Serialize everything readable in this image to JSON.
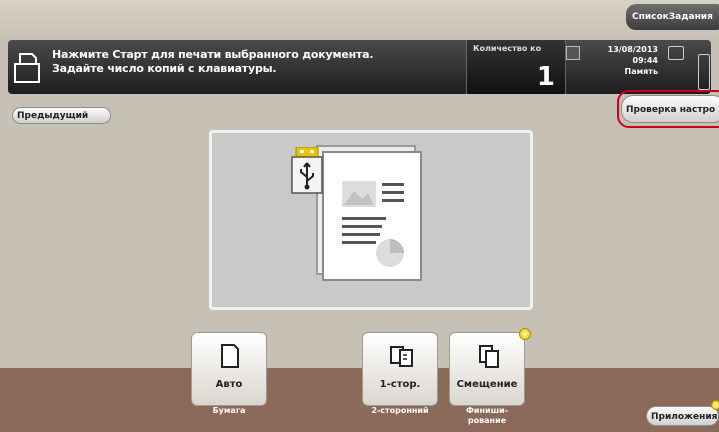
{
  "header": {
    "job_list_label": "СписокЗадания",
    "message_line1": "Нажмите Старт для печати выбранного документа.",
    "message_line2": "Задайте число копий с клавиатуры.",
    "copies_label": "Количество ко",
    "copies_value": "1",
    "date": "13/08/2013",
    "time": "09:44",
    "memory_label": "Память"
  },
  "nav": {
    "previous_label": "Предыдущий",
    "check_settings_label": "Проверка настро"
  },
  "preview": {
    "document_icon": "document-preview-icon",
    "source_icon": "usb-icon"
  },
  "functions": [
    {
      "label": "Авто",
      "caption": "Бумага",
      "icon": "paper-icon"
    },
    {
      "label": "1-стор.",
      "caption": "2-сторонний",
      "icon": "duplex-icon"
    },
    {
      "label": "Смещение",
      "caption1": "Финиши-",
      "caption2": "рование",
      "icon": "finishing-icon"
    }
  ],
  "apps_label": "Приложения",
  "colors": {
    "highlight": "#c8001f",
    "bottom_band": "#8c6a5a",
    "indicator": "#e2c400"
  }
}
